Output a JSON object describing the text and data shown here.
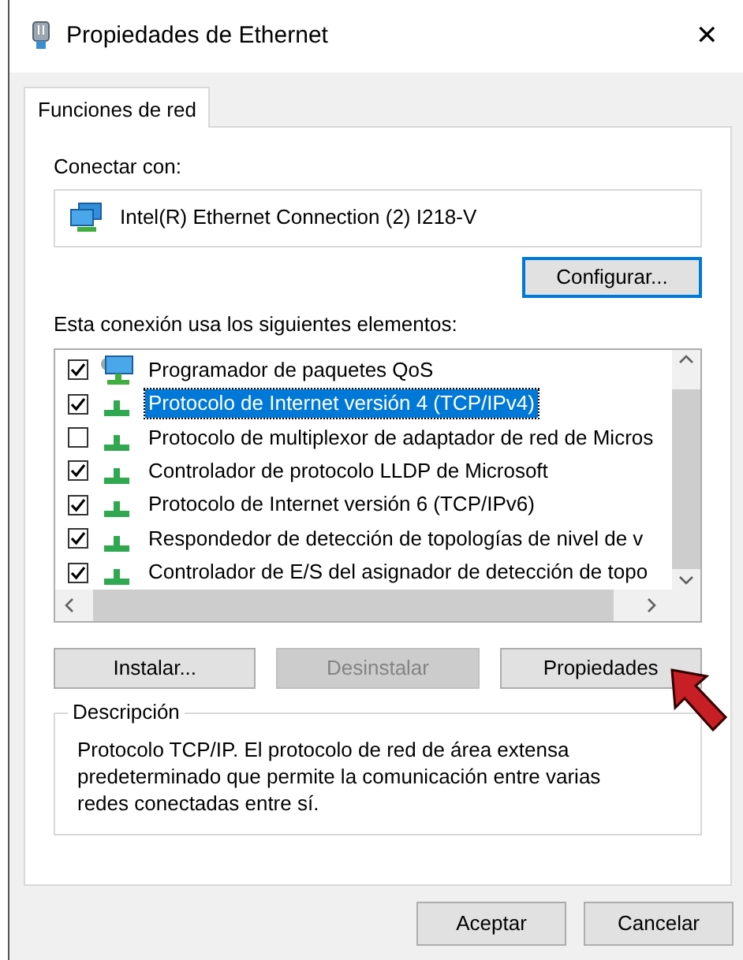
{
  "window": {
    "title": "Propiedades de Ethernet",
    "close": "✕"
  },
  "tabs": [
    {
      "label": "Funciones de red",
      "selected": true
    }
  ],
  "connect": {
    "label": "Conectar con:",
    "adapter": "Intel(R) Ethernet Connection (2) I218-V",
    "configure_button": "Configurar..."
  },
  "components": {
    "label": "Esta conexión usa los siguientes elementos:",
    "items": [
      {
        "kind": "scheduler",
        "label": "Programador de paquetes QoS",
        "checked": true,
        "selected": false
      },
      {
        "kind": "protocol",
        "label": "Protocolo de Internet versión 4 (TCP/IPv4)",
        "checked": true,
        "selected": true
      },
      {
        "kind": "protocol",
        "label": "Protocolo de multiplexor de adaptador de red de Micros",
        "checked": false,
        "selected": false
      },
      {
        "kind": "protocol",
        "label": "Controlador de protocolo LLDP de Microsoft",
        "checked": true,
        "selected": false
      },
      {
        "kind": "protocol",
        "label": "Protocolo de Internet versión 6 (TCP/IPv6)",
        "checked": true,
        "selected": false
      },
      {
        "kind": "protocol",
        "label": "Respondedor de detección de topologías de nivel de v",
        "checked": true,
        "selected": false
      },
      {
        "kind": "protocol",
        "label": "Controlador de E/S del asignador de detección de topo",
        "checked": true,
        "selected": false
      }
    ]
  },
  "actions": [
    {
      "label": "Instalar...",
      "disabled": false
    },
    {
      "label": "Desinstalar",
      "disabled": true
    },
    {
      "label": "Propiedades",
      "disabled": false
    }
  ],
  "description": {
    "legend": "Descripción",
    "text": "Protocolo TCP/IP. El protocolo de red de área extensa predeterminado que permite la comunicación entre varias redes conectadas entre sí."
  },
  "dialog_buttons": [
    "Aceptar",
    "Cancelar"
  ]
}
